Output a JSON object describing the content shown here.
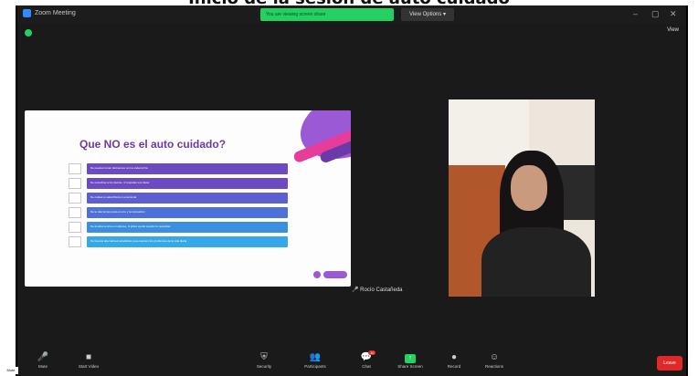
{
  "window": {
    "title": "Zoom Meeting",
    "share_banner": "You are viewing screen share",
    "view_options": "View Options ▾",
    "view_label": "View"
  },
  "slide": {
    "title": "Que NO es el auto cuidado?",
    "bullets": [
      "No puedes tomar decisiones con la cabeza fría",
      "No escuchas a los demás, ni respetas sus ideas",
      "No cuidas tu salud física ni emocional",
      "No te das tiempo para el ocio y la recreación",
      "No ayudas a otros a cuidarse, ni pides ayuda cuando la necesitas",
      "No buscas alternativas saludables para resolver los problemas de la vida diaria"
    ],
    "bullet_colors": [
      "#6c4bc2",
      "#6c4bc2",
      "#5c5fcf",
      "#4d71d8",
      "#3b8ee0",
      "#34a8e8"
    ]
  },
  "speaker": {
    "name": "Rocío Castañeda"
  },
  "toolbar": {
    "items": [
      {
        "icon": "🎤",
        "label": "Mute"
      },
      {
        "icon": "■",
        "label": "Start Video"
      },
      {
        "icon": "⛨",
        "label": "Security"
      },
      {
        "icon": "👥",
        "label": "Participants"
      },
      {
        "icon": "💬",
        "label": "Chat"
      },
      {
        "icon": "↑",
        "label": "Share Screen"
      },
      {
        "icon": "●",
        "label": "Record"
      },
      {
        "icon": "☺",
        "label": "Reactions"
      }
    ],
    "chat_badge": "10",
    "end_label": "Leave",
    "tooltip": "Mute"
  }
}
